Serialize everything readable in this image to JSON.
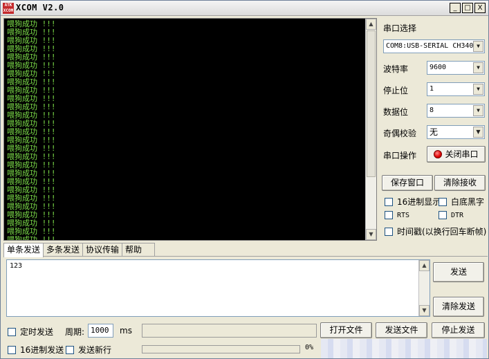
{
  "window": {
    "title": "XCOM V2.0",
    "logo_text": "ATK\nXCOM",
    "controls": {
      "minimize": "_",
      "maximize": "□",
      "close": "X"
    }
  },
  "receive": {
    "lines": [
      "喂狗成功 !!!",
      "喂狗成功 !!!",
      "喂狗成功 !!!",
      "喂狗成功 !!!",
      "喂狗成功 !!!",
      "喂狗成功 !!!",
      "喂狗成功 !!!",
      "喂狗成功 !!!",
      "喂狗成功 !!!",
      "喂狗成功 !!!",
      "喂狗成功 !!!",
      "喂狗成功 !!!",
      "喂狗成功 !!!",
      "喂狗成功 !!!",
      "喂狗成功 !!!",
      "喂狗成功 !!!",
      "喂狗成功 !!!",
      "喂狗成功 !!!",
      "喂狗成功 !!!",
      "喂狗成功 !!!",
      "喂狗成功 !!!",
      "喂狗成功 !!!",
      "喂狗成功 !!!",
      "喂狗成功 !!!",
      "喂狗成功 !!!",
      "喂狗成功 !!!",
      "喂狗成功 !!!"
    ],
    "text_color": "#7ee04a"
  },
  "settings": {
    "port_label": "串口选择",
    "port_value": "COM8:USB-SERIAL CH340",
    "baud_label": "波特率",
    "baud_value": "9600",
    "stop_label": "停止位",
    "stop_value": "1",
    "data_label": "数据位",
    "data_value": "8",
    "parity_label": "奇偶校验",
    "parity_value": "无",
    "op_label": "串口操作",
    "op_button": "关闭串口",
    "save_window": "保存窗口",
    "clear_receive": "清除接收",
    "hex_display": "16进制显示",
    "white_bg": "白底黑字",
    "rts": "RTS",
    "dtr": "DTR",
    "timestamp": "时间戳(以换行回车断帧)"
  },
  "tabs": [
    "单条发送",
    "多条发送",
    "协议传输",
    "帮助"
  ],
  "send": {
    "text": "123",
    "send_button": "发送",
    "clear_send_button": "清除发送",
    "timed_send": "定时发送",
    "period_label": "周期:",
    "period_value": "1000",
    "period_unit": "ms",
    "open_file": "打开文件",
    "send_file": "发送文件",
    "stop_send": "停止发送",
    "hex_send": "16进制发送",
    "send_newline": "发送新行",
    "progress_text": "0%",
    "progress_percent": 0
  }
}
